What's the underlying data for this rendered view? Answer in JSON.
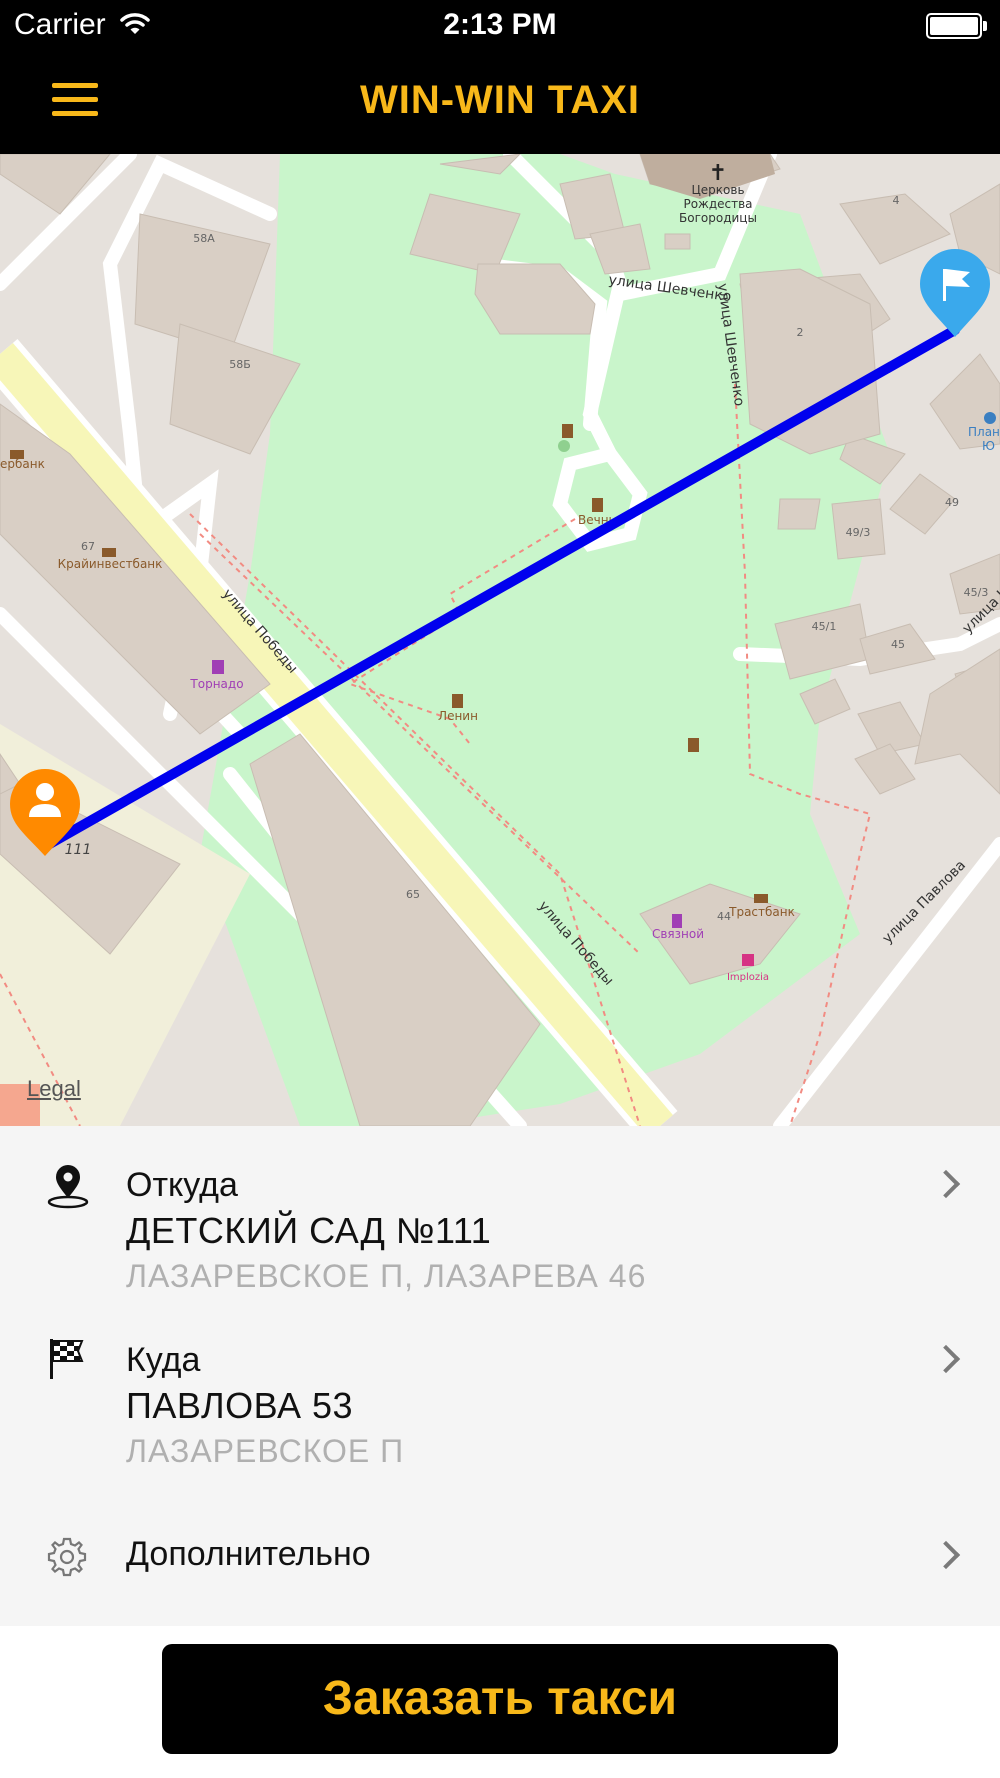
{
  "status_bar": {
    "carrier": "Carrier",
    "time": "2:13 PM"
  },
  "header": {
    "title": "WIN-WIN TAXI",
    "menu_icon": "hamburger-menu-icon"
  },
  "map": {
    "legal_label": "Legal",
    "route_color": "#0000ee",
    "origin_marker_color": "#ff8a00",
    "destination_marker_color": "#3aa9ec",
    "labels": {
      "church": [
        "Церковь",
        "Рождества",
        "Богородицы"
      ],
      "street_shevchenko": "улица Шевченко",
      "street_shevchenko_v": "улица Шевченко",
      "street_pobedy_1": "улица Победы",
      "street_pobedy_2": "улица Победы",
      "street_pavlova": "улица Павлова",
      "b58a": "58А",
      "b58b": "58Б",
      "b4": "4",
      "b2": "2",
      "b49": "49",
      "b49_3": "49/3",
      "b45_1": "45/1",
      "b45": "45",
      "b45_3": "45/3",
      "b65": "65",
      "b67": "67",
      "b44": "44",
      "b111": "111",
      "sberbank": "ербанк",
      "krayinvest": "Крайинвестбанк",
      "tornado": "Торнадо",
      "lenin": "Ленин",
      "vechny": "Вечны",
      "trastbank": "Трастбанк",
      "svyaznoy": "Связной",
      "implozia": "Implozia",
      "plan": "Плане",
      "yu": "Ю"
    }
  },
  "from": {
    "label": "Откуда",
    "title": "ДЕТСКИЙ САД №111",
    "subtitle": "ЛАЗАРЕВСКОЕ П, ЛАЗАРЕВА 46"
  },
  "to": {
    "label": "Куда",
    "title": "ПАВЛОВА 53",
    "subtitle": "ЛАЗАРЕВСКОЕ П"
  },
  "options": {
    "label": "Дополнительно"
  },
  "order_button": {
    "label": "Заказать такси"
  },
  "colors": {
    "accent": "#f8b81a",
    "bar": "#000000",
    "panel": "#f5f5f5"
  }
}
